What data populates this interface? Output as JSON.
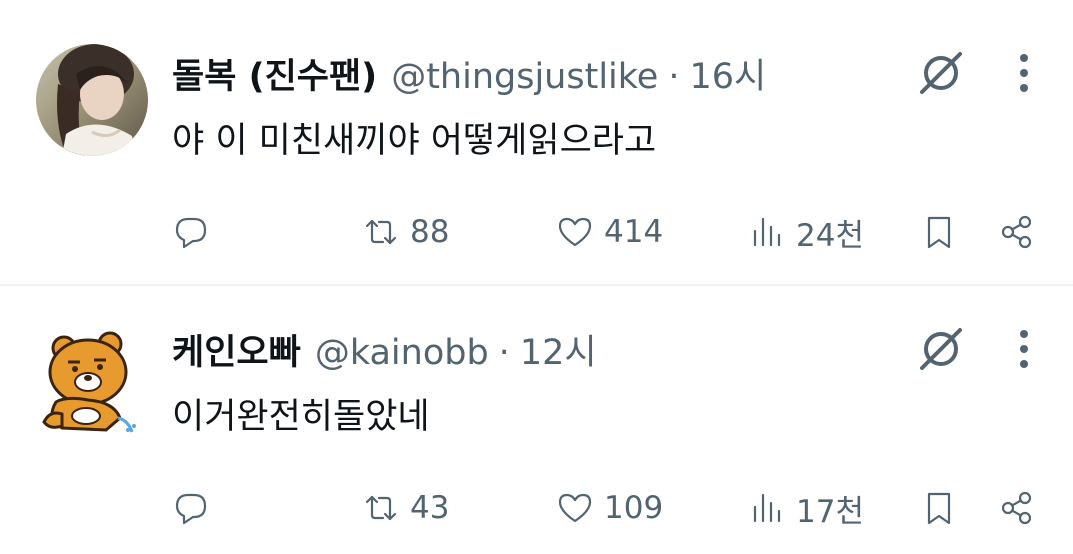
{
  "tweets": [
    {
      "name": "돌복 (진수팬)",
      "handle": "@thingsjustlike",
      "separator": "·",
      "time": "16시",
      "text": "야 이 미친새끼야 어떻게읽으라고",
      "replies": "",
      "retweets": "88",
      "likes": "414",
      "views": "24천"
    },
    {
      "name": "케인오빠",
      "handle": "@kainobb",
      "separator": "·",
      "time": "12시",
      "text": "이거완전히돌았네",
      "replies": "",
      "retweets": "43",
      "likes": "109",
      "views": "17천"
    }
  ],
  "icons": {
    "reply": "reply-icon",
    "retweet": "retweet-icon",
    "like": "heart-icon",
    "views": "views-icon",
    "bookmark": "bookmark-icon",
    "share": "share-icon",
    "grok": "grok-icon",
    "more": "more-icon"
  },
  "colors": {
    "text": "#0f1419",
    "secondary": "#536471",
    "divider": "#eff3f4"
  }
}
